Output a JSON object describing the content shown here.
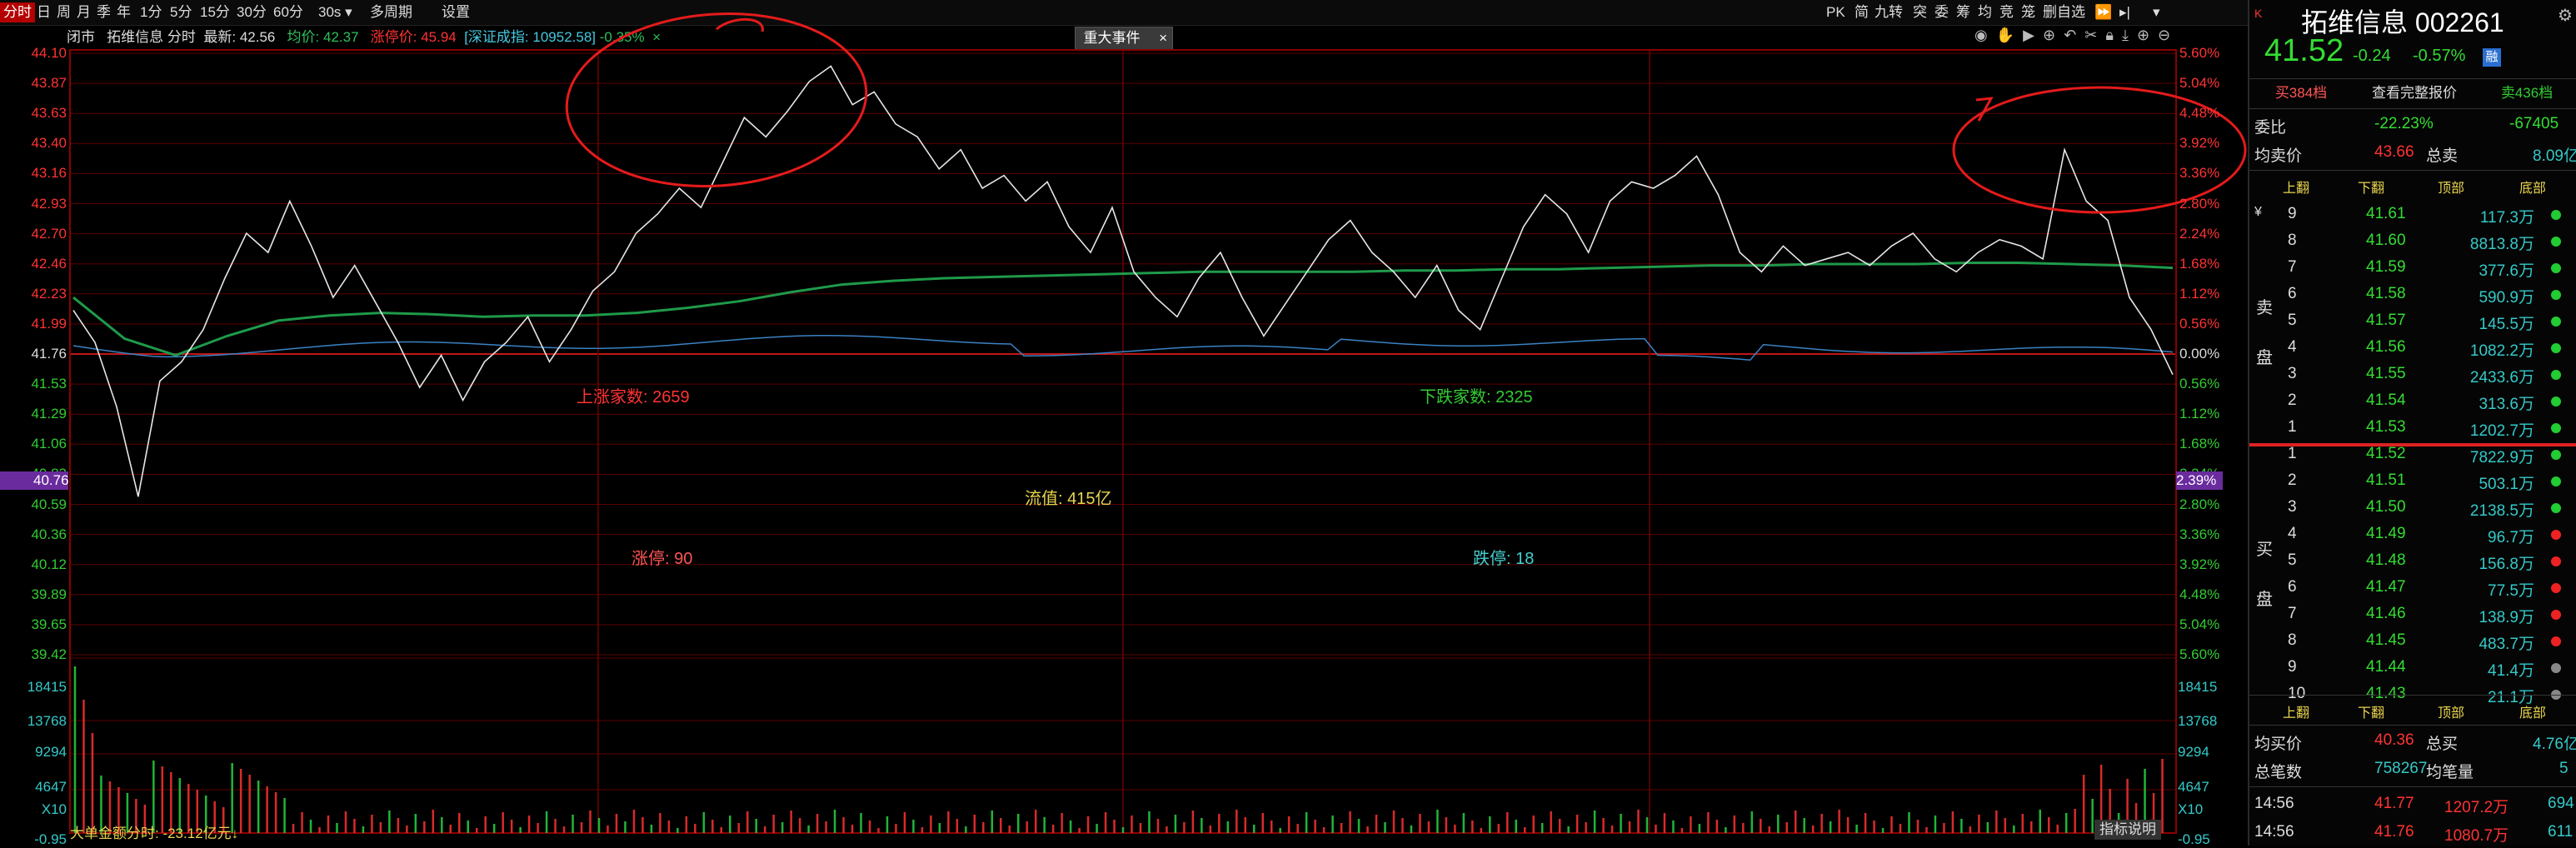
{
  "toolbar": {
    "periods": [
      "分时",
      "日",
      "周",
      "月",
      "季",
      "年",
      "1分",
      "5分",
      "15分",
      "30分",
      "60分"
    ],
    "active_period": "分时",
    "interval": "30s",
    "multi_period": "多周期",
    "settings": "设置",
    "right_tools": [
      "PK",
      "简",
      "九转",
      "突",
      "委",
      "筹",
      "均",
      "竞",
      "笼",
      "删自选"
    ]
  },
  "infobar": {
    "status": "闭市",
    "name": "拓维信息 分时",
    "latest_label": "最新:",
    "latest": "42.56",
    "avg_label": "均价:",
    "avg": "42.37",
    "limit_up_label": "涨停价:",
    "limit_up": "45.94",
    "index": "[深证成指: 10952.58]",
    "index_change": "-0.35%",
    "event_button": "重大事件"
  },
  "axes": {
    "left_prices": [
      "44.10",
      "43.87",
      "43.63",
      "43.40",
      "43.16",
      "42.93",
      "42.70",
      "42.46",
      "42.23",
      "41.99",
      "41.76",
      "41.53",
      "41.29",
      "41.06",
      "40.83",
      "40.59",
      "40.36",
      "40.12",
      "39.89",
      "39.65",
      "39.42"
    ],
    "right_pcts": [
      "5.60%",
      "5.04%",
      "4.48%",
      "3.92%",
      "3.36%",
      "2.80%",
      "2.24%",
      "1.68%",
      "1.12%",
      "0.56%",
      "0.00%",
      "0.56%",
      "1.12%",
      "1.68%",
      "2.24%",
      "2.80%",
      "3.36%",
      "3.92%",
      "4.48%",
      "5.04%",
      "5.60%"
    ],
    "highlight_left": "40.76",
    "highlight_right": "2.39%",
    "vol_left": [
      "18415",
      "13768",
      "9294",
      "4647",
      "X10"
    ],
    "vol_right": [
      "18415",
      "13768",
      "9294",
      "4647",
      "X10"
    ],
    "bottom_left": "-0.95",
    "bottom_right": "-0.95"
  },
  "overlay": {
    "up_count": "上涨家数: 2659",
    "down_count": "下跌家数: 2325",
    "float_value": "流值: 415亿",
    "limit_up_count": "涨停: 90",
    "limit_down_count": "跌停: 18",
    "big_order": "大单金额分时: -23.12亿元↓",
    "indicator_help": "指标说明"
  },
  "chart_data": {
    "type": "line",
    "series": [
      {
        "values": [
          42.1,
          41.85,
          41.35,
          40.65,
          41.55,
          41.7,
          41.95,
          42.35,
          42.7,
          42.55,
          42.95,
          42.6,
          42.2,
          42.45,
          42.15,
          41.85,
          41.5,
          41.75,
          41.4,
          41.7,
          41.85,
          42.05,
          41.7,
          41.95,
          42.25,
          42.4,
          42.7,
          42.85,
          43.05,
          42.9,
          43.25,
          43.6,
          43.45,
          43.65,
          43.88,
          44.0,
          43.7,
          43.8,
          43.55,
          43.45,
          43.2,
          43.35,
          43.05,
          43.15,
          42.95,
          43.1,
          42.75,
          42.55,
          42.9,
          42.4,
          42.2,
          42.05,
          42.35,
          42.55,
          42.2,
          41.9,
          42.15,
          42.4,
          42.65,
          42.8,
          42.55,
          42.4,
          42.2,
          42.45,
          42.1,
          41.95,
          42.35,
          42.75,
          43.0,
          42.85,
          42.55,
          42.95,
          43.1,
          43.05,
          43.15,
          43.3,
          43.0,
          42.55,
          42.4,
          42.6,
          42.45,
          42.5,
          42.55,
          42.45,
          42.6,
          42.7,
          42.5,
          42.4,
          42.55,
          42.65,
          42.6,
          42.5,
          43.35,
          42.95,
          42.8,
          42.2,
          41.95,
          41.6
        ]
      }
    ],
    "avg_line_values": [
      42.2,
      41.88,
      41.75,
      41.9,
      42.02,
      42.06,
      42.08,
      42.07,
      42.05,
      42.06,
      42.06,
      42.08,
      42.12,
      42.17,
      42.24,
      42.3,
      42.33,
      42.35,
      42.36,
      42.37,
      42.38,
      42.39,
      42.4,
      42.4,
      42.4,
      42.4,
      42.41,
      42.41,
      42.42,
      42.42,
      42.43,
      42.44,
      42.45,
      42.45,
      42.46,
      42.46,
      42.46,
      42.47,
      42.47,
      42.46,
      42.45,
      42.43
    ],
    "ref_line": 41.76,
    "ylim": [
      39.42,
      44.1
    ]
  },
  "panel": {
    "title": "拓维信息 002261",
    "price": "41.52",
    "change": "-0.24",
    "change_pct": "-0.57%",
    "badge": "融",
    "buttons": [
      "买384档",
      "查看完整报价",
      "卖436档"
    ],
    "ratio_label": "委比",
    "ratio": "-22.23%",
    "ratio_diff": "-67405",
    "avg_sell_label": "均卖价",
    "avg_sell": "43.66",
    "total_sell_label": "总卖",
    "total_sell": "8.09亿",
    "col_headers": [
      "上翻",
      "下翻",
      "顶部",
      "底部"
    ],
    "sell_label": "卖盘",
    "buy_label": "买盘",
    "sells": [
      {
        "level": "9",
        "price": "41.61",
        "vol": "117.3万"
      },
      {
        "level": "8",
        "price": "41.60",
        "vol": "8813.8万"
      },
      {
        "level": "7",
        "price": "41.59",
        "vol": "377.6万"
      },
      {
        "level": "6",
        "price": "41.58",
        "vol": "590.9万"
      },
      {
        "level": "5",
        "price": "41.57",
        "vol": "145.5万"
      },
      {
        "level": "4",
        "price": "41.56",
        "vol": "1082.2万"
      },
      {
        "level": "3",
        "price": "41.55",
        "vol": "2433.6万"
      },
      {
        "level": "2",
        "price": "41.54",
        "vol": "313.6万"
      },
      {
        "level": "1",
        "price": "41.53",
        "vol": "1202.7万"
      }
    ],
    "buys": [
      {
        "level": "1",
        "price": "41.52",
        "vol": "7822.9万"
      },
      {
        "level": "2",
        "price": "41.51",
        "vol": "503.1万"
      },
      {
        "level": "3",
        "price": "41.50",
        "vol": "2138.5万"
      },
      {
        "level": "4",
        "price": "41.49",
        "vol": "96.7万"
      },
      {
        "level": "5",
        "price": "41.48",
        "vol": "156.8万"
      },
      {
        "level": "6",
        "price": "41.47",
        "vol": "77.5万"
      },
      {
        "level": "7",
        "price": "41.46",
        "vol": "138.9万"
      },
      {
        "level": "8",
        "price": "41.45",
        "vol": "483.7万"
      },
      {
        "level": "9",
        "price": "41.44",
        "vol": "41.4万"
      },
      {
        "level": "10",
        "price": "41.43",
        "vol": "21.1万"
      }
    ],
    "avg_buy_label": "均买价",
    "avg_buy": "40.36",
    "total_buy_label": "总买",
    "total_buy": "4.76亿",
    "trades_label": "总笔数",
    "trades": "758267",
    "avg_vol_label": "均笔量",
    "avg_vol": "5",
    "ticks": [
      {
        "time": "14:56",
        "price": "41.77",
        "vol": "1207.2万",
        "n": "694"
      },
      {
        "time": "14:56",
        "price": "41.76",
        "vol": "1080.7万",
        "n": "611"
      }
    ]
  },
  "colors": {
    "up": "#ff3333",
    "down": "#33cc33",
    "cyan": "#44d0d0",
    "yellow": "#e8d44d",
    "grid": "#7a0000",
    "price_line": "#e6e6e6",
    "avg_line": "#1f9a4a"
  }
}
